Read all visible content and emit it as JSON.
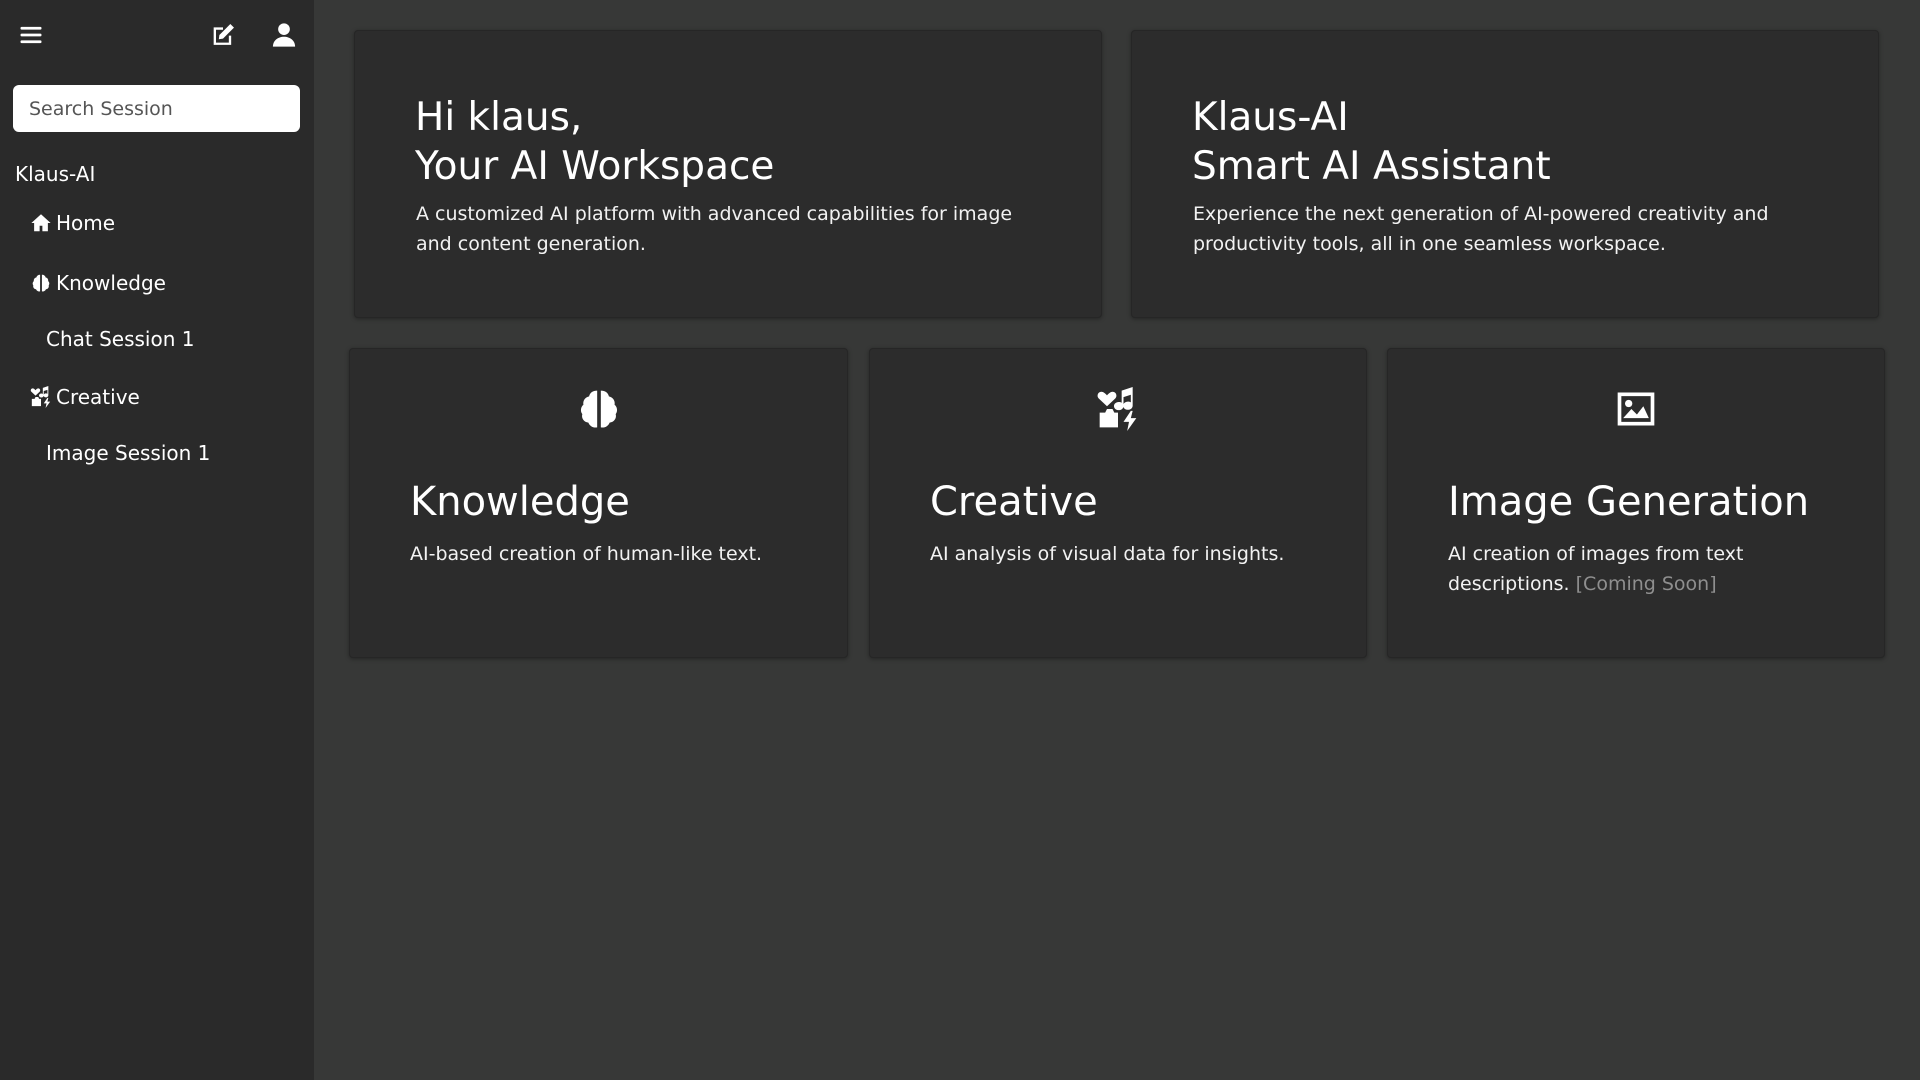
{
  "sidebar": {
    "search_placeholder": "Search Session",
    "brand": "Klaus-AI",
    "nav": {
      "home": "Home",
      "knowledge": "Knowledge",
      "chat_session": "Chat Session 1",
      "creative": "Creative",
      "image_session": "Image Session 1"
    }
  },
  "hero": {
    "left": {
      "title_line1": "Hi klaus,",
      "title_line2": "Your AI Workspace",
      "description": "A customized AI platform with advanced capabilities for image and content generation."
    },
    "right": {
      "title_line1": "Klaus-AI",
      "title_line2": "Smart AI Assistant",
      "description": "Experience the next generation of AI-powered creativity and productivity tools, all in one seamless workspace."
    }
  },
  "features": {
    "knowledge": {
      "title": "Knowledge",
      "description": "AI-based creation of human-like text."
    },
    "creative": {
      "title": "Creative",
      "description": "AI analysis of visual data for insights."
    },
    "image": {
      "title": "Image Generation",
      "description": "AI creation of images from text descriptions.",
      "badge": "[Coming Soon]"
    }
  },
  "colors": {
    "background": "#373837",
    "sidebar": "#2a2a2a",
    "card": "#2c2c2c",
    "text": "#ffffff",
    "muted": "#8f8f8f"
  }
}
